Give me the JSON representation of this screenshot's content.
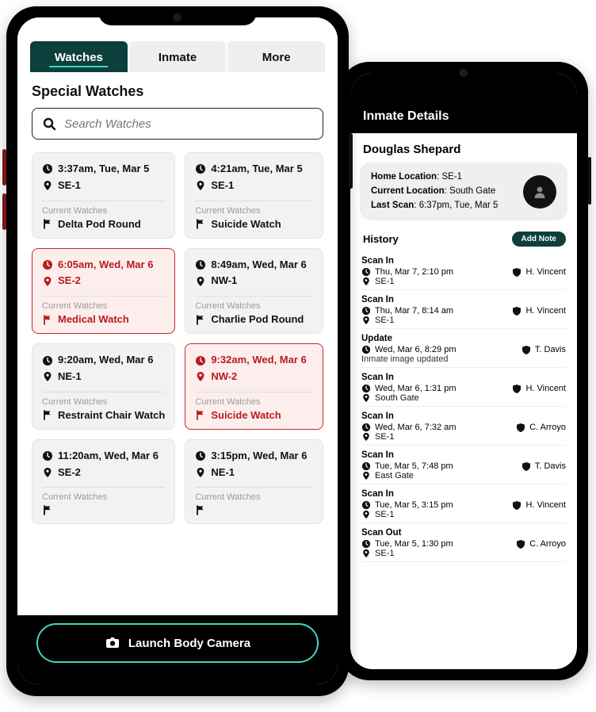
{
  "tabs": {
    "watches": "Watches",
    "inmate": "Inmate",
    "more": "More"
  },
  "title": "Special Watches",
  "search": {
    "placeholder": "Search Watches"
  },
  "labels": {
    "current_watches": "Current Watches"
  },
  "camera_btn": "Launch Body Camera",
  "cards": [
    {
      "time": "3:37am, Tue, Mar 5",
      "loc": "SE-1",
      "watch": "Delta Pod Round",
      "alert": false
    },
    {
      "time": "4:21am, Tue, Mar 5",
      "loc": "SE-1",
      "watch": "Suicide Watch",
      "alert": false
    },
    {
      "time": "6:05am, Wed, Mar 6",
      "loc": "SE-2",
      "watch": "Medical Watch",
      "alert": true
    },
    {
      "time": "8:49am, Wed, Mar 6",
      "loc": "NW-1",
      "watch": "Charlie Pod Round",
      "alert": false
    },
    {
      "time": "9:20am, Wed, Mar 6",
      "loc": "NE-1",
      "watch": "Restraint Chair Watch",
      "alert": false
    },
    {
      "time": "9:32am, Wed, Mar 6",
      "loc": "NW-2",
      "watch": "Suicide Watch",
      "alert": true
    },
    {
      "time": "11:20am, Wed, Mar 6",
      "loc": "SE-2",
      "watch": "",
      "alert": false
    },
    {
      "time": "3:15pm, Wed, Mar 6",
      "loc": "NE-1",
      "watch": "",
      "alert": false
    }
  ],
  "details": {
    "header": "Inmate Details",
    "name": "Douglas Shepard",
    "home_lbl": "Home Location",
    "home_val": ": SE-1",
    "curr_lbl": "Current Location",
    "curr_val": ": South Gate",
    "scan_lbl": "Last Scan",
    "scan_val": ": 6:37pm, Tue, Mar 5",
    "history_title": "History",
    "add_note": "Add Note",
    "items": [
      {
        "type": "Scan In",
        "time": "Thu, Mar 7, 2:10 pm",
        "loc": "SE-1",
        "who": "H. Vincent"
      },
      {
        "type": "Scan In",
        "time": "Thu, Mar 7, 8:14 am",
        "loc": "SE-1",
        "who": "H. Vincent"
      },
      {
        "type": "Update",
        "time": "Wed, Mar 6, 8:29 pm",
        "note": "Inmate image updated",
        "who": "T. Davis"
      },
      {
        "type": "Scan In",
        "time": "Wed, Mar 6, 1:31 pm",
        "loc": "South Gate",
        "who": "H. Vincent"
      },
      {
        "type": "Scan In",
        "time": "Wed, Mar 6, 7:32 am",
        "loc": "SE-1",
        "who": "C. Arroyo"
      },
      {
        "type": "Scan In",
        "time": "Tue, Mar 5, 7:48 pm",
        "loc": "East Gate",
        "who": "T. Davis"
      },
      {
        "type": "Scan In",
        "time": "Tue, Mar 5, 3:15 pm",
        "loc": "SE-1",
        "who": "H. Vincent"
      },
      {
        "type": "Scan Out",
        "time": "Tue, Mar 5, 1:30 pm",
        "loc": "SE-1",
        "who": "C. Arroyo"
      }
    ]
  }
}
